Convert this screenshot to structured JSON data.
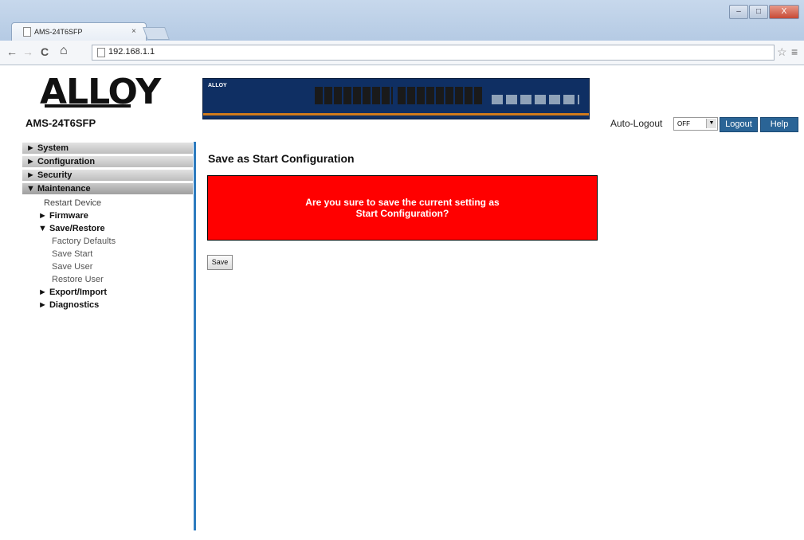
{
  "browser": {
    "tab_title": "AMS-24T6SFP",
    "tab_close": "×",
    "url": "192.168.1.1",
    "back": "←",
    "forward": "→",
    "reload": "C",
    "home": "⌂",
    "star": "☆",
    "menu": "≡",
    "minimize": "–",
    "maximize": "□",
    "close": "X"
  },
  "header": {
    "logo_text": "ALLOY",
    "model": "AMS-24T6SFP",
    "switch_brand": "ALLOY",
    "auto_logout_label": "Auto-Logout",
    "auto_logout_value": "OFF",
    "logout_label": "Logout",
    "help_label": "Help"
  },
  "sidebar": {
    "system": "► System",
    "configuration": "► Configuration",
    "security": "► Security",
    "maintenance": "▼ Maintenance",
    "restart_device": "Restart Device",
    "firmware": "► Firmware",
    "save_restore": "▼ Save/Restore",
    "factory_defaults": "Factory Defaults",
    "save_start": "Save Start",
    "save_user": "Save User",
    "restore_user": "Restore User",
    "export_import": "► Export/Import",
    "diagnostics": "► Diagnostics"
  },
  "main": {
    "title": "Save as Start Configuration",
    "alert_line1": "Are you sure to save the current setting as",
    "alert_line2": "Start Configuration?",
    "save_label": "Save"
  },
  "colors": {
    "accent": "#2d7bbf",
    "alert": "#ff0000",
    "button_blue": "#2a6496"
  }
}
